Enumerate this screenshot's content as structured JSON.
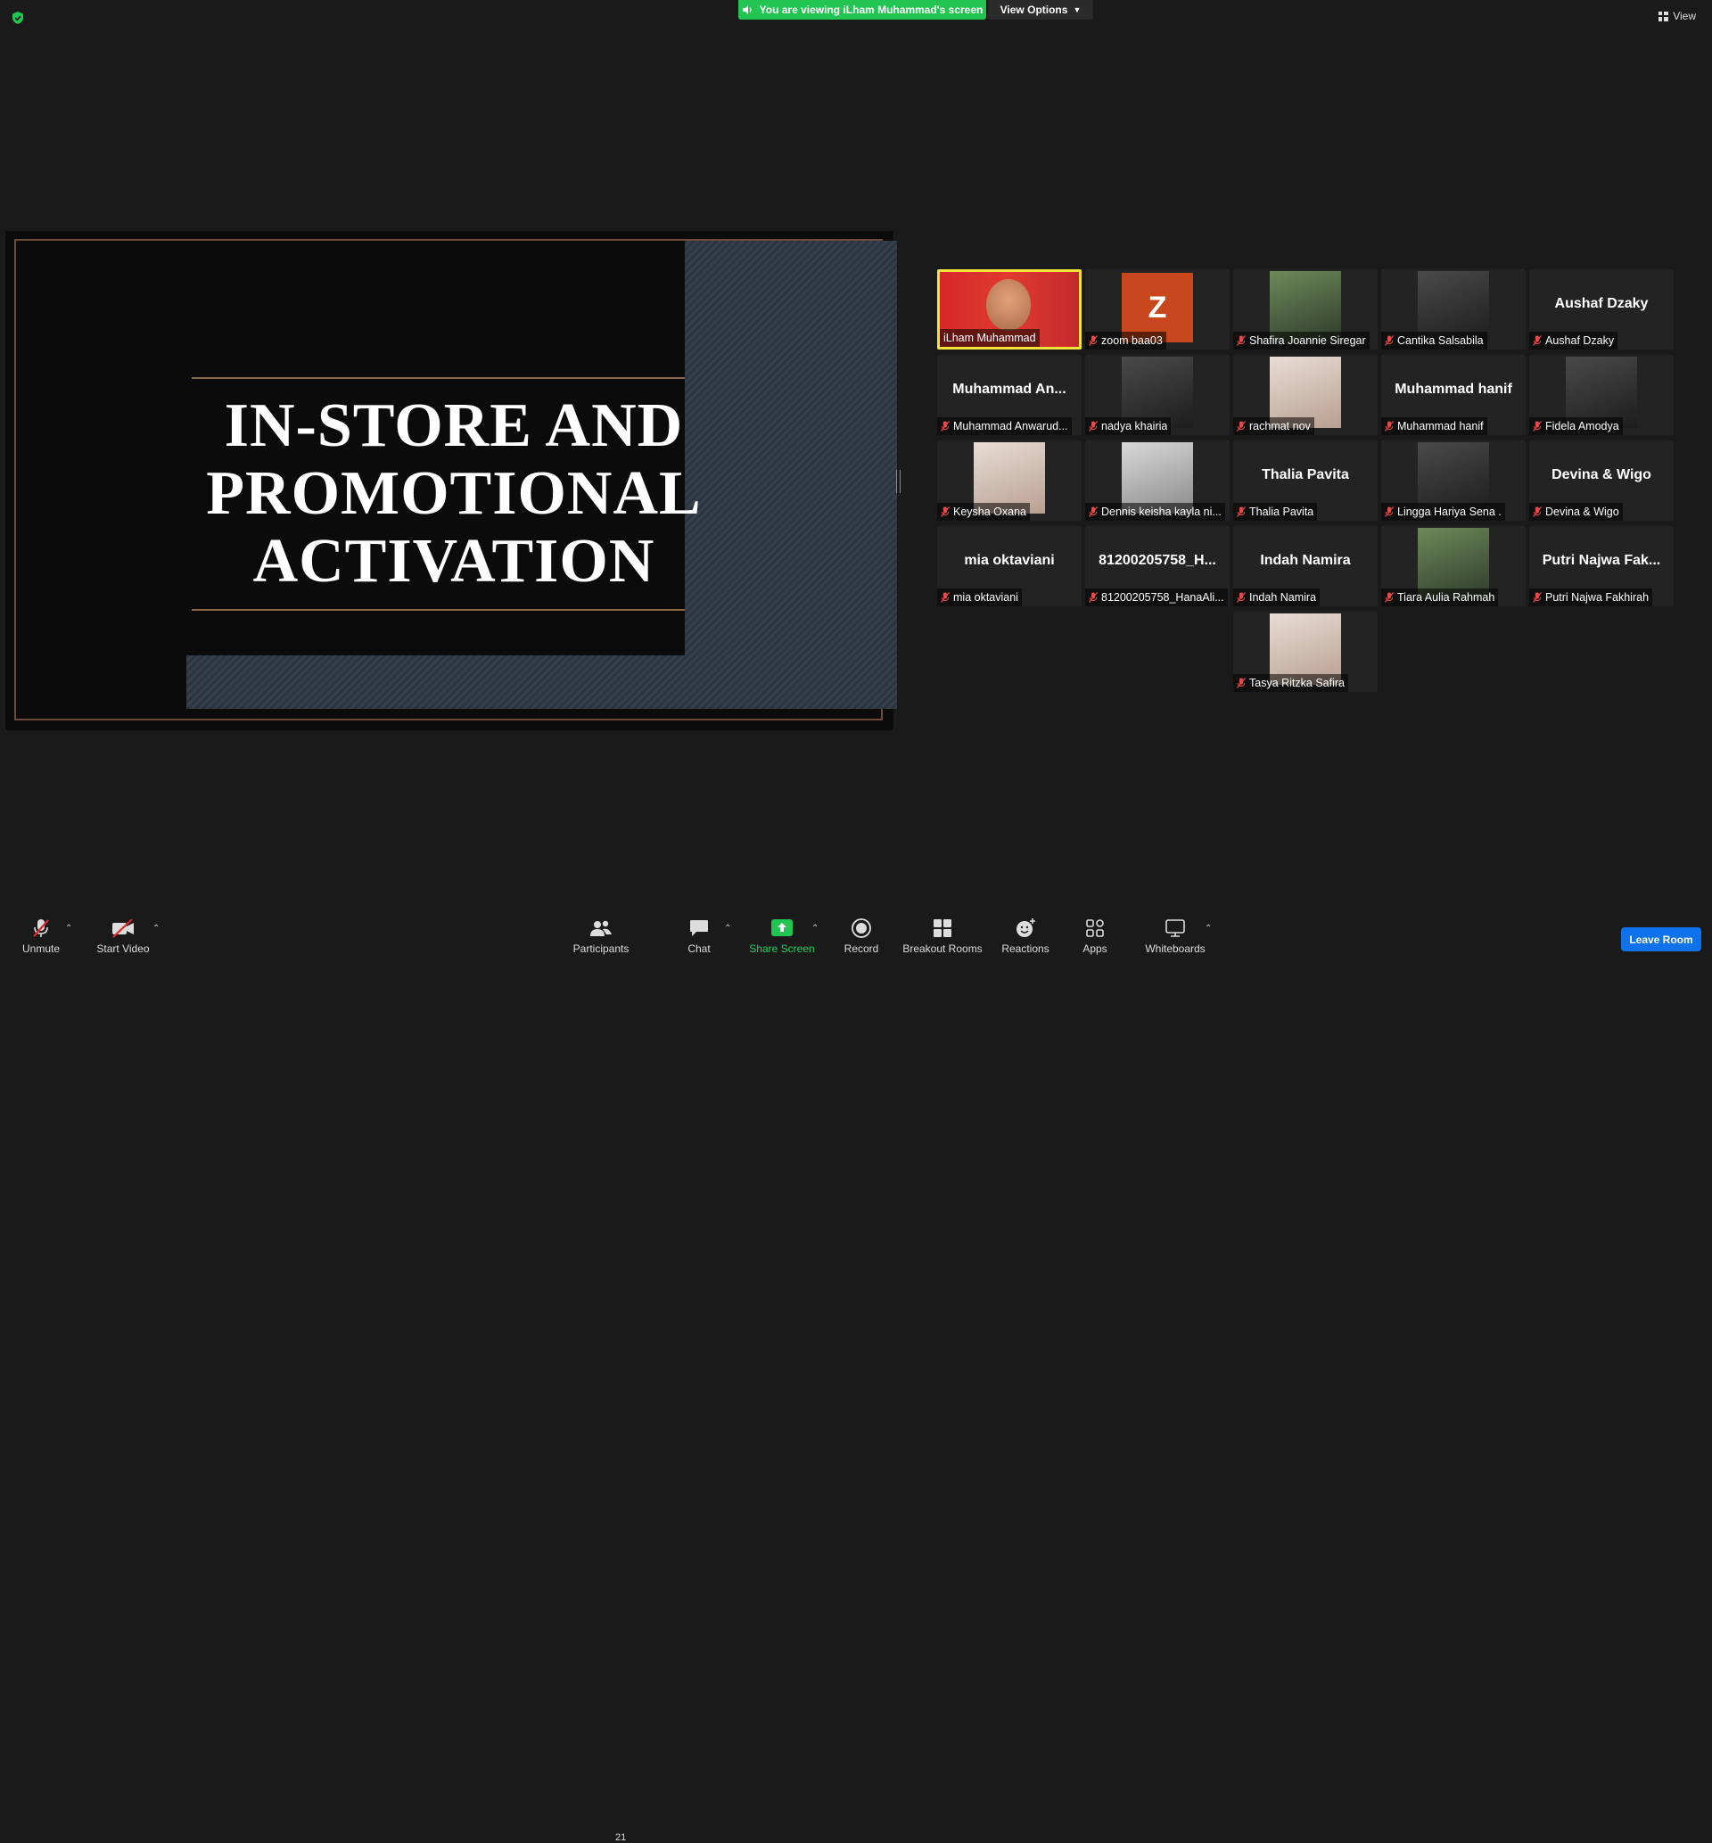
{
  "top": {
    "banner_text": "You are viewing iLham Muhammad's screen",
    "view_options": "View Options",
    "view": "View"
  },
  "slide": {
    "title_lines": [
      "IN-STORE AND",
      "PROMOTIONAL",
      "ACTIVATION"
    ]
  },
  "participants": [
    {
      "name": "iLham Muhammad",
      "display": "",
      "type": "host-video"
    },
    {
      "name": "zoom baa03",
      "display": "Z",
      "type": "avatar"
    },
    {
      "name": "Shafira Joannie Siregar",
      "display": "",
      "type": "photo"
    },
    {
      "name": "Cantika Salsabila",
      "display": "",
      "type": "photo"
    },
    {
      "name": "Aushaf Dzaky",
      "display": "Aushaf Dzaky",
      "type": "text"
    },
    {
      "name": "Muhammad Anwarud...",
      "display": "Muhammad An...",
      "type": "text"
    },
    {
      "name": "nadya khairia",
      "display": "",
      "type": "photo"
    },
    {
      "name": "rachmat nov",
      "display": "",
      "type": "photo"
    },
    {
      "name": "Muhammad hanif",
      "display": "Muhammad hanif",
      "type": "text"
    },
    {
      "name": "Fidela Amodya",
      "display": "",
      "type": "photo"
    },
    {
      "name": "Keysha Oxana",
      "display": "",
      "type": "photo"
    },
    {
      "name": "Dennis keisha kayla ni...",
      "display": "",
      "type": "photo"
    },
    {
      "name": "Thalia Pavita",
      "display": "Thalia Pavita",
      "type": "text"
    },
    {
      "name": "Lingga Hariya Sena .",
      "display": "",
      "type": "photo"
    },
    {
      "name": "Devina & Wigo",
      "display": "Devina & Wigo",
      "type": "text"
    },
    {
      "name": "mia oktaviani",
      "display": "mia oktaviani",
      "type": "text"
    },
    {
      "name": "81200205758_HanaAli...",
      "display": "81200205758_H...",
      "type": "text"
    },
    {
      "name": "Indah Namira",
      "display": "Indah Namira",
      "type": "text"
    },
    {
      "name": "Tiara Aulia Rahmah",
      "display": "",
      "type": "photo"
    },
    {
      "name": "Putri Najwa Fakhirah",
      "display": "Putri Najwa Fak...",
      "type": "text"
    },
    {
      "name": "Tasya Ritzka Safira",
      "display": "",
      "type": "photo"
    }
  ],
  "toolbar": {
    "unmute": "Unmute",
    "start_video": "Start Video",
    "participants": "Participants",
    "participants_count": "21",
    "chat": "Chat",
    "share_screen": "Share Screen",
    "record": "Record",
    "breakout_rooms": "Breakout Rooms",
    "reactions": "Reactions",
    "apps": "Apps",
    "whiteboards": "Whiteboards",
    "leave_room": "Leave Room"
  },
  "colors": {
    "banner_green": "#23c552",
    "active_speaker": "#f3e33b",
    "leave_blue": "#0e72ed"
  }
}
